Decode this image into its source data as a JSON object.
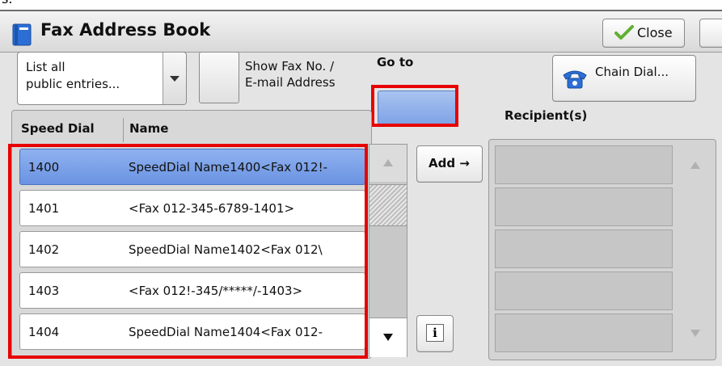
{
  "header": {
    "title": "Fax Address Book",
    "close_label": "Close"
  },
  "filter": {
    "dropdown_value": "List all\npublic entries...",
    "show_fax_label": "Show Fax No. /\nE-mail Address"
  },
  "goto": {
    "label": "Go to",
    "value": ""
  },
  "chain_dial": {
    "label": "Chain Dial..."
  },
  "recipients": {
    "label": "Recipient(s)",
    "slots": [
      "",
      "",
      "",
      "",
      ""
    ]
  },
  "list": {
    "columns": [
      "Speed Dial",
      "Name"
    ],
    "selected_index": 0,
    "rows": [
      {
        "speed_dial": "1400",
        "name": "SpeedDial Name1400<Fax 012!-"
      },
      {
        "speed_dial": "1401",
        "name": "<Fax 012-345-6789-1401>"
      },
      {
        "speed_dial": "1402",
        "name": "SpeedDial Name1402<Fax 012\\"
      },
      {
        "speed_dial": "1403",
        "name": "<Fax 012!-345/*****/-1403>"
      },
      {
        "speed_dial": "1404",
        "name": "SpeedDial Name1404<Fax 012-"
      }
    ]
  },
  "actions": {
    "add_label": "Add →"
  },
  "colors": {
    "highlight": "#e60000",
    "selected_row": "#7fa3e6",
    "goto_field": "#8fb1ef"
  }
}
